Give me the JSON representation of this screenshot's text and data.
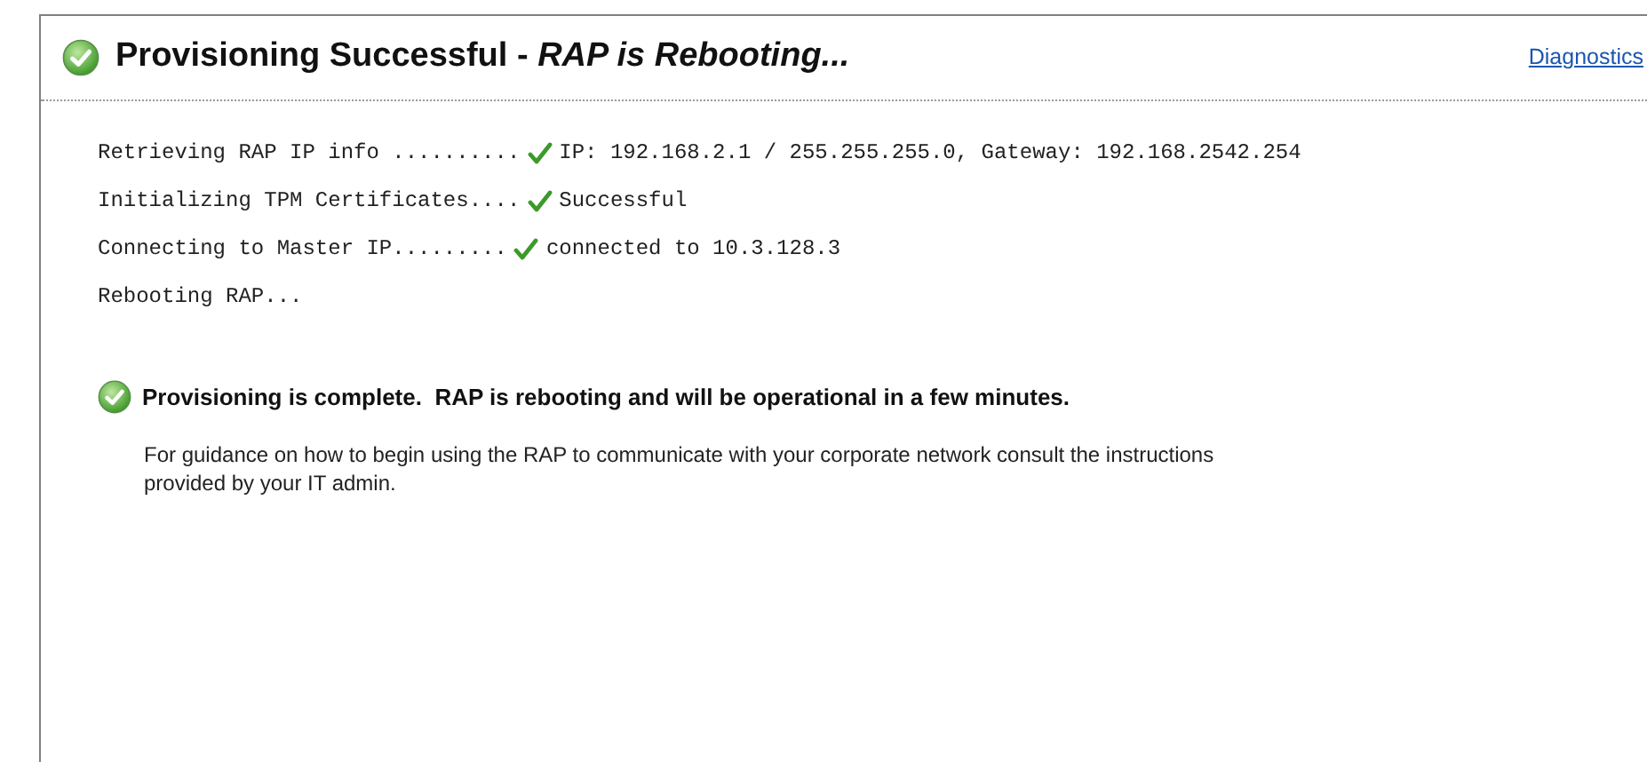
{
  "header": {
    "title": "Provisioning Successful - *RAP is Rebooting...*",
    "link": "Diagnostics"
  },
  "steps": [
    {
      "label": "Retrieving RAP IP info ..........",
      "kind": "done",
      "result": "IP: 192.168.2.1 / 255.255.255.0, Gateway: 192.168.2542.254"
    },
    {
      "label": "Initializing TPM Certificates....",
      "kind": "done",
      "result": "Successful"
    },
    {
      "label": "Connecting to Master IP.........",
      "kind": "done",
      "result": "connected to 10.3.128.3"
    },
    {
      "label": "Rebooting RAP...",
      "kind": "pending"
    }
  ],
  "message": {
    "headline": "Provisioning is complete.  RAP is rebooting and will be operational in a few minutes.",
    "body": "For guidance on how to begin using the RAP to communicate with your corporate network consult the instructions provided by your IT admin."
  }
}
